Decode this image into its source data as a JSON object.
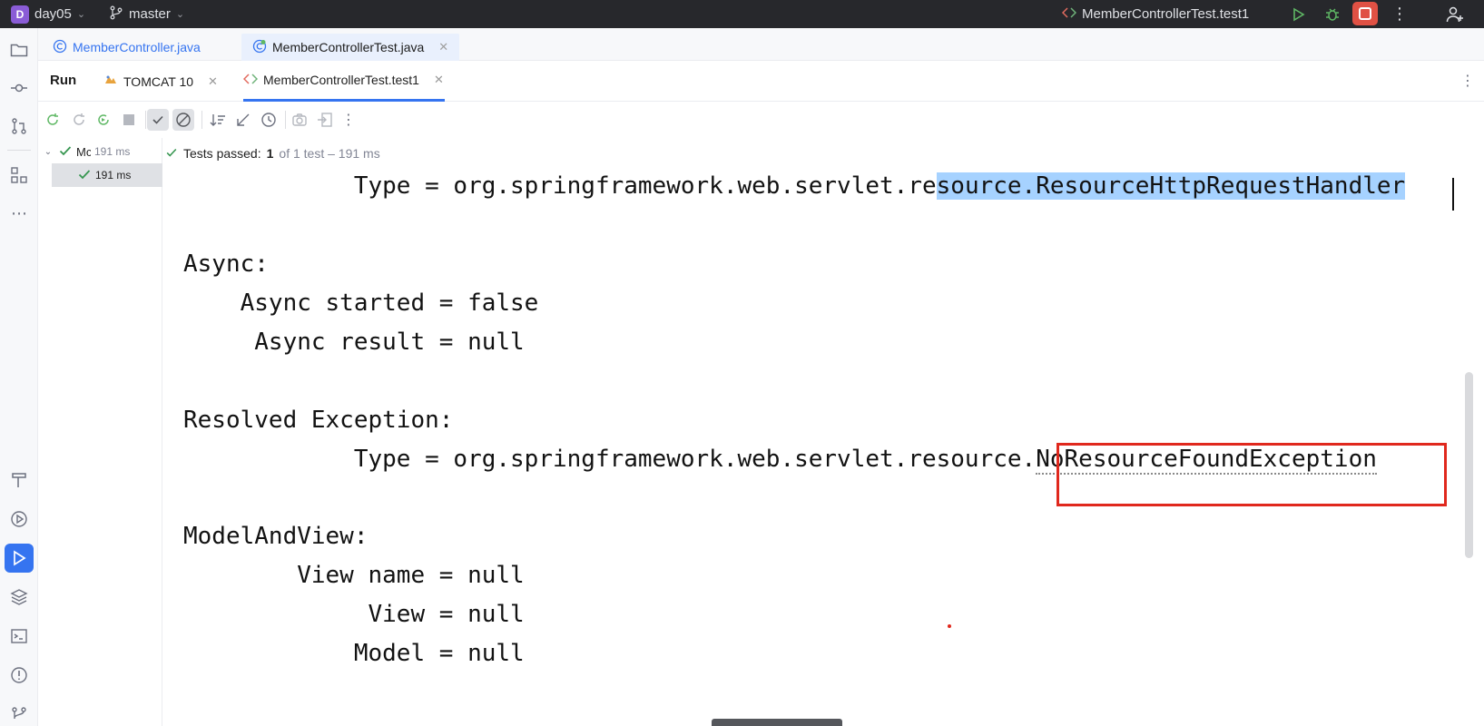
{
  "titlebar": {
    "project_badge": "D",
    "project_name": "day05",
    "branch_name": "master",
    "run_config": "MemberControllerTest.test1",
    "icons": [
      "run-icon",
      "debug-icon",
      "stop-icon",
      "more-icon",
      "add-user-icon"
    ]
  },
  "editor_tabs": [
    {
      "label": "MemberController.java",
      "selected": false
    },
    {
      "label": "MemberControllerTest.java",
      "selected": true
    }
  ],
  "run_window": {
    "title": "Run",
    "tabs": [
      {
        "label": "TOMCAT 10",
        "selected": false
      },
      {
        "label": "MemberControllerTest.test1",
        "selected": true
      }
    ]
  },
  "test_tree": {
    "root": {
      "label": "Mc",
      "time": "191 ms"
    },
    "child": {
      "time": "191 ms"
    }
  },
  "status": {
    "prefix": "Tests passed:",
    "passed": "1",
    "rest": "of 1 test – 191 ms"
  },
  "console": {
    "line1_a": "            Type = org.springframework.web.servlet.re",
    "line1_b": "source.ResourceHttpRequestHandler",
    "line2": "Async:",
    "line3": "    Async started = false",
    "line4": "     Async result = null",
    "line5": "Resolved Exception:",
    "line6_a": "            Type = org.springframework.web.servlet.resource.",
    "line6_b": "NoResourceFoundException",
    "line7": "ModelAndView:",
    "line8": "        View name = null",
    "line9": "             View = null",
    "line10": "            Model = null"
  },
  "colors": {
    "accent": "#3574f0",
    "pass_green": "#369650",
    "highlight": "#a6d2ff",
    "annotation_red": "#e0281d",
    "titlebar_bg": "#27282c"
  }
}
